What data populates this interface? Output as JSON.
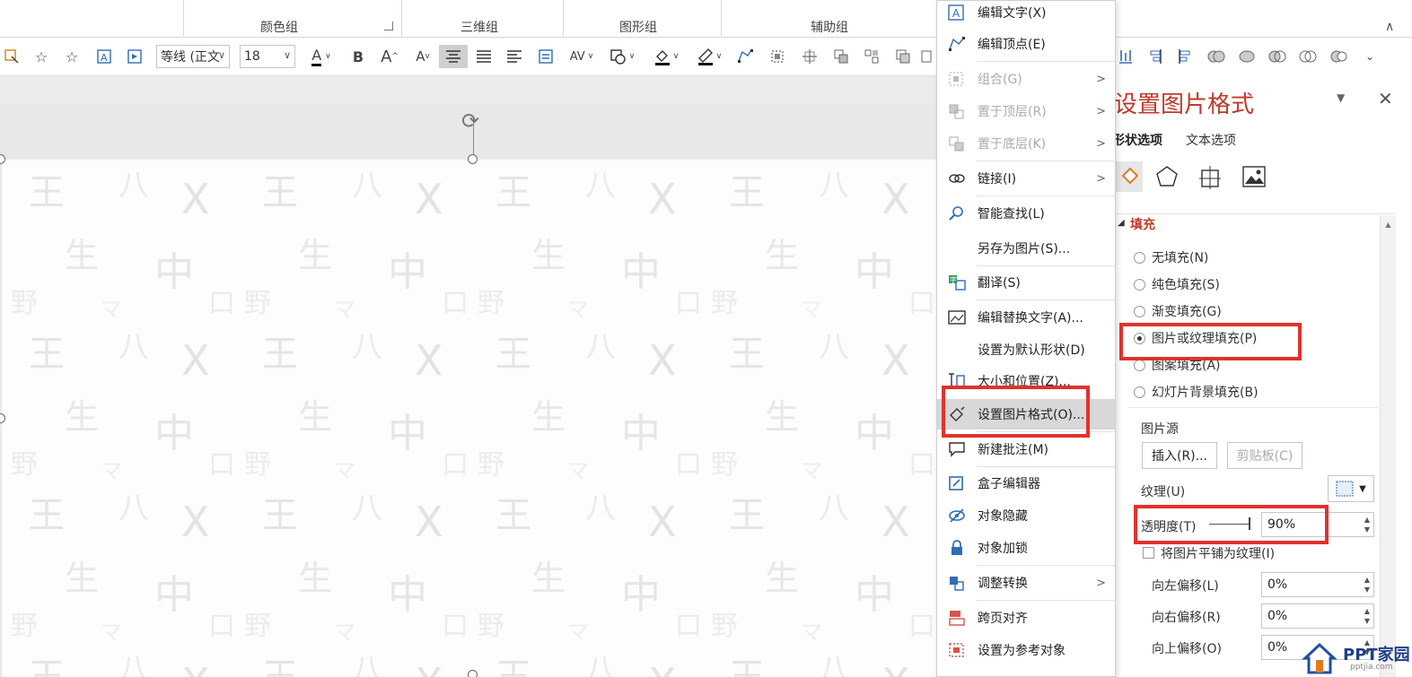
{
  "ribbon": {
    "groups": [
      "颜色组",
      "三维组",
      "图形组",
      "辅助组"
    ]
  },
  "toolbar": {
    "font_name": "等线 (正文",
    "font_size": "18",
    "bold": "B",
    "grow": "A",
    "shrink": "A",
    "letter_spacing": "AV"
  },
  "context_menu": {
    "items": [
      {
        "label": "编辑文字(X)",
        "icon": "edit-text-icon",
        "disabled": false,
        "submenu": false
      },
      {
        "label": "编辑顶点(E)",
        "icon": "edit-points-icon",
        "disabled": false,
        "submenu": false
      },
      {
        "label": "组合(G)",
        "icon": "group-icon",
        "disabled": true,
        "submenu": true
      },
      {
        "label": "置于顶层(R)",
        "icon": "bring-front-icon",
        "disabled": true,
        "submenu": true
      },
      {
        "label": "置于底层(K)",
        "icon": "send-back-icon",
        "disabled": true,
        "submenu": true
      },
      {
        "label": "链接(I)",
        "icon": "link-icon",
        "disabled": false,
        "submenu": true
      },
      {
        "label": "智能查找(L)",
        "icon": "smart-lookup-icon",
        "disabled": false,
        "submenu": false
      },
      {
        "label": "另存为图片(S)...",
        "icon": "",
        "disabled": false,
        "submenu": false
      },
      {
        "label": "翻译(S)",
        "icon": "translate-icon",
        "disabled": false,
        "submenu": false
      },
      {
        "label": "编辑替换文字(A)...",
        "icon": "alt-text-icon",
        "disabled": false,
        "submenu": false
      },
      {
        "label": "设置为默认形状(D)",
        "icon": "",
        "disabled": false,
        "submenu": false
      },
      {
        "label": "大小和位置(Z)...",
        "icon": "size-position-icon",
        "disabled": false,
        "submenu": false
      },
      {
        "label": "设置图片格式(O)...",
        "icon": "format-picture-icon",
        "disabled": false,
        "submenu": false
      },
      {
        "label": "新建批注(M)",
        "icon": "new-comment-icon",
        "disabled": false,
        "submenu": false
      },
      {
        "label": "盒子编辑器",
        "icon": "box-editor-icon",
        "disabled": false,
        "submenu": false
      },
      {
        "label": "对象隐藏",
        "icon": "hide-object-icon",
        "disabled": false,
        "submenu": false
      },
      {
        "label": "对象加锁",
        "icon": "lock-icon",
        "disabled": false,
        "submenu": false
      },
      {
        "label": "调整转换",
        "icon": "adjust-convert-icon",
        "disabled": false,
        "submenu": true
      },
      {
        "label": "跨页对齐",
        "icon": "cross-page-align-icon",
        "disabled": false,
        "submenu": false
      },
      {
        "label": "设置为参考对象",
        "icon": "reference-object-icon",
        "disabled": false,
        "submenu": false
      }
    ]
  },
  "panel": {
    "title": "设置图片格式",
    "tabs": [
      "形状选项",
      "文本选项"
    ],
    "section": "填充",
    "fill_options": [
      {
        "label": "无填充(N)",
        "selected": false
      },
      {
        "label": "纯色填充(S)",
        "selected": false
      },
      {
        "label": "渐变填充(G)",
        "selected": false
      },
      {
        "label": "图片或纹理填充(P)",
        "selected": true
      },
      {
        "label": "图案填充(A)",
        "selected": false
      },
      {
        "label": "幻灯片背景填充(B)",
        "selected": false
      }
    ],
    "picture_source": "图片源",
    "insert_button": "插入(R)...",
    "clipboard_button": "剪贴板(C)",
    "texture_label": "纹理(U)",
    "transparency_label": "透明度(T)",
    "transparency_value": "90%",
    "tile_label": "将图片平铺为纹理(I)",
    "offsets": [
      {
        "label": "向左偏移(L)",
        "value": "0%"
      },
      {
        "label": "向右偏移(R)",
        "value": "0%"
      },
      {
        "label": "向上偏移(O)",
        "value": "0%"
      }
    ]
  },
  "logo": {
    "text": "PPT家园",
    "sub": "pptjia.com"
  },
  "colors": {
    "accent_red": "#e0322d",
    "title_red": "#c0392b"
  }
}
